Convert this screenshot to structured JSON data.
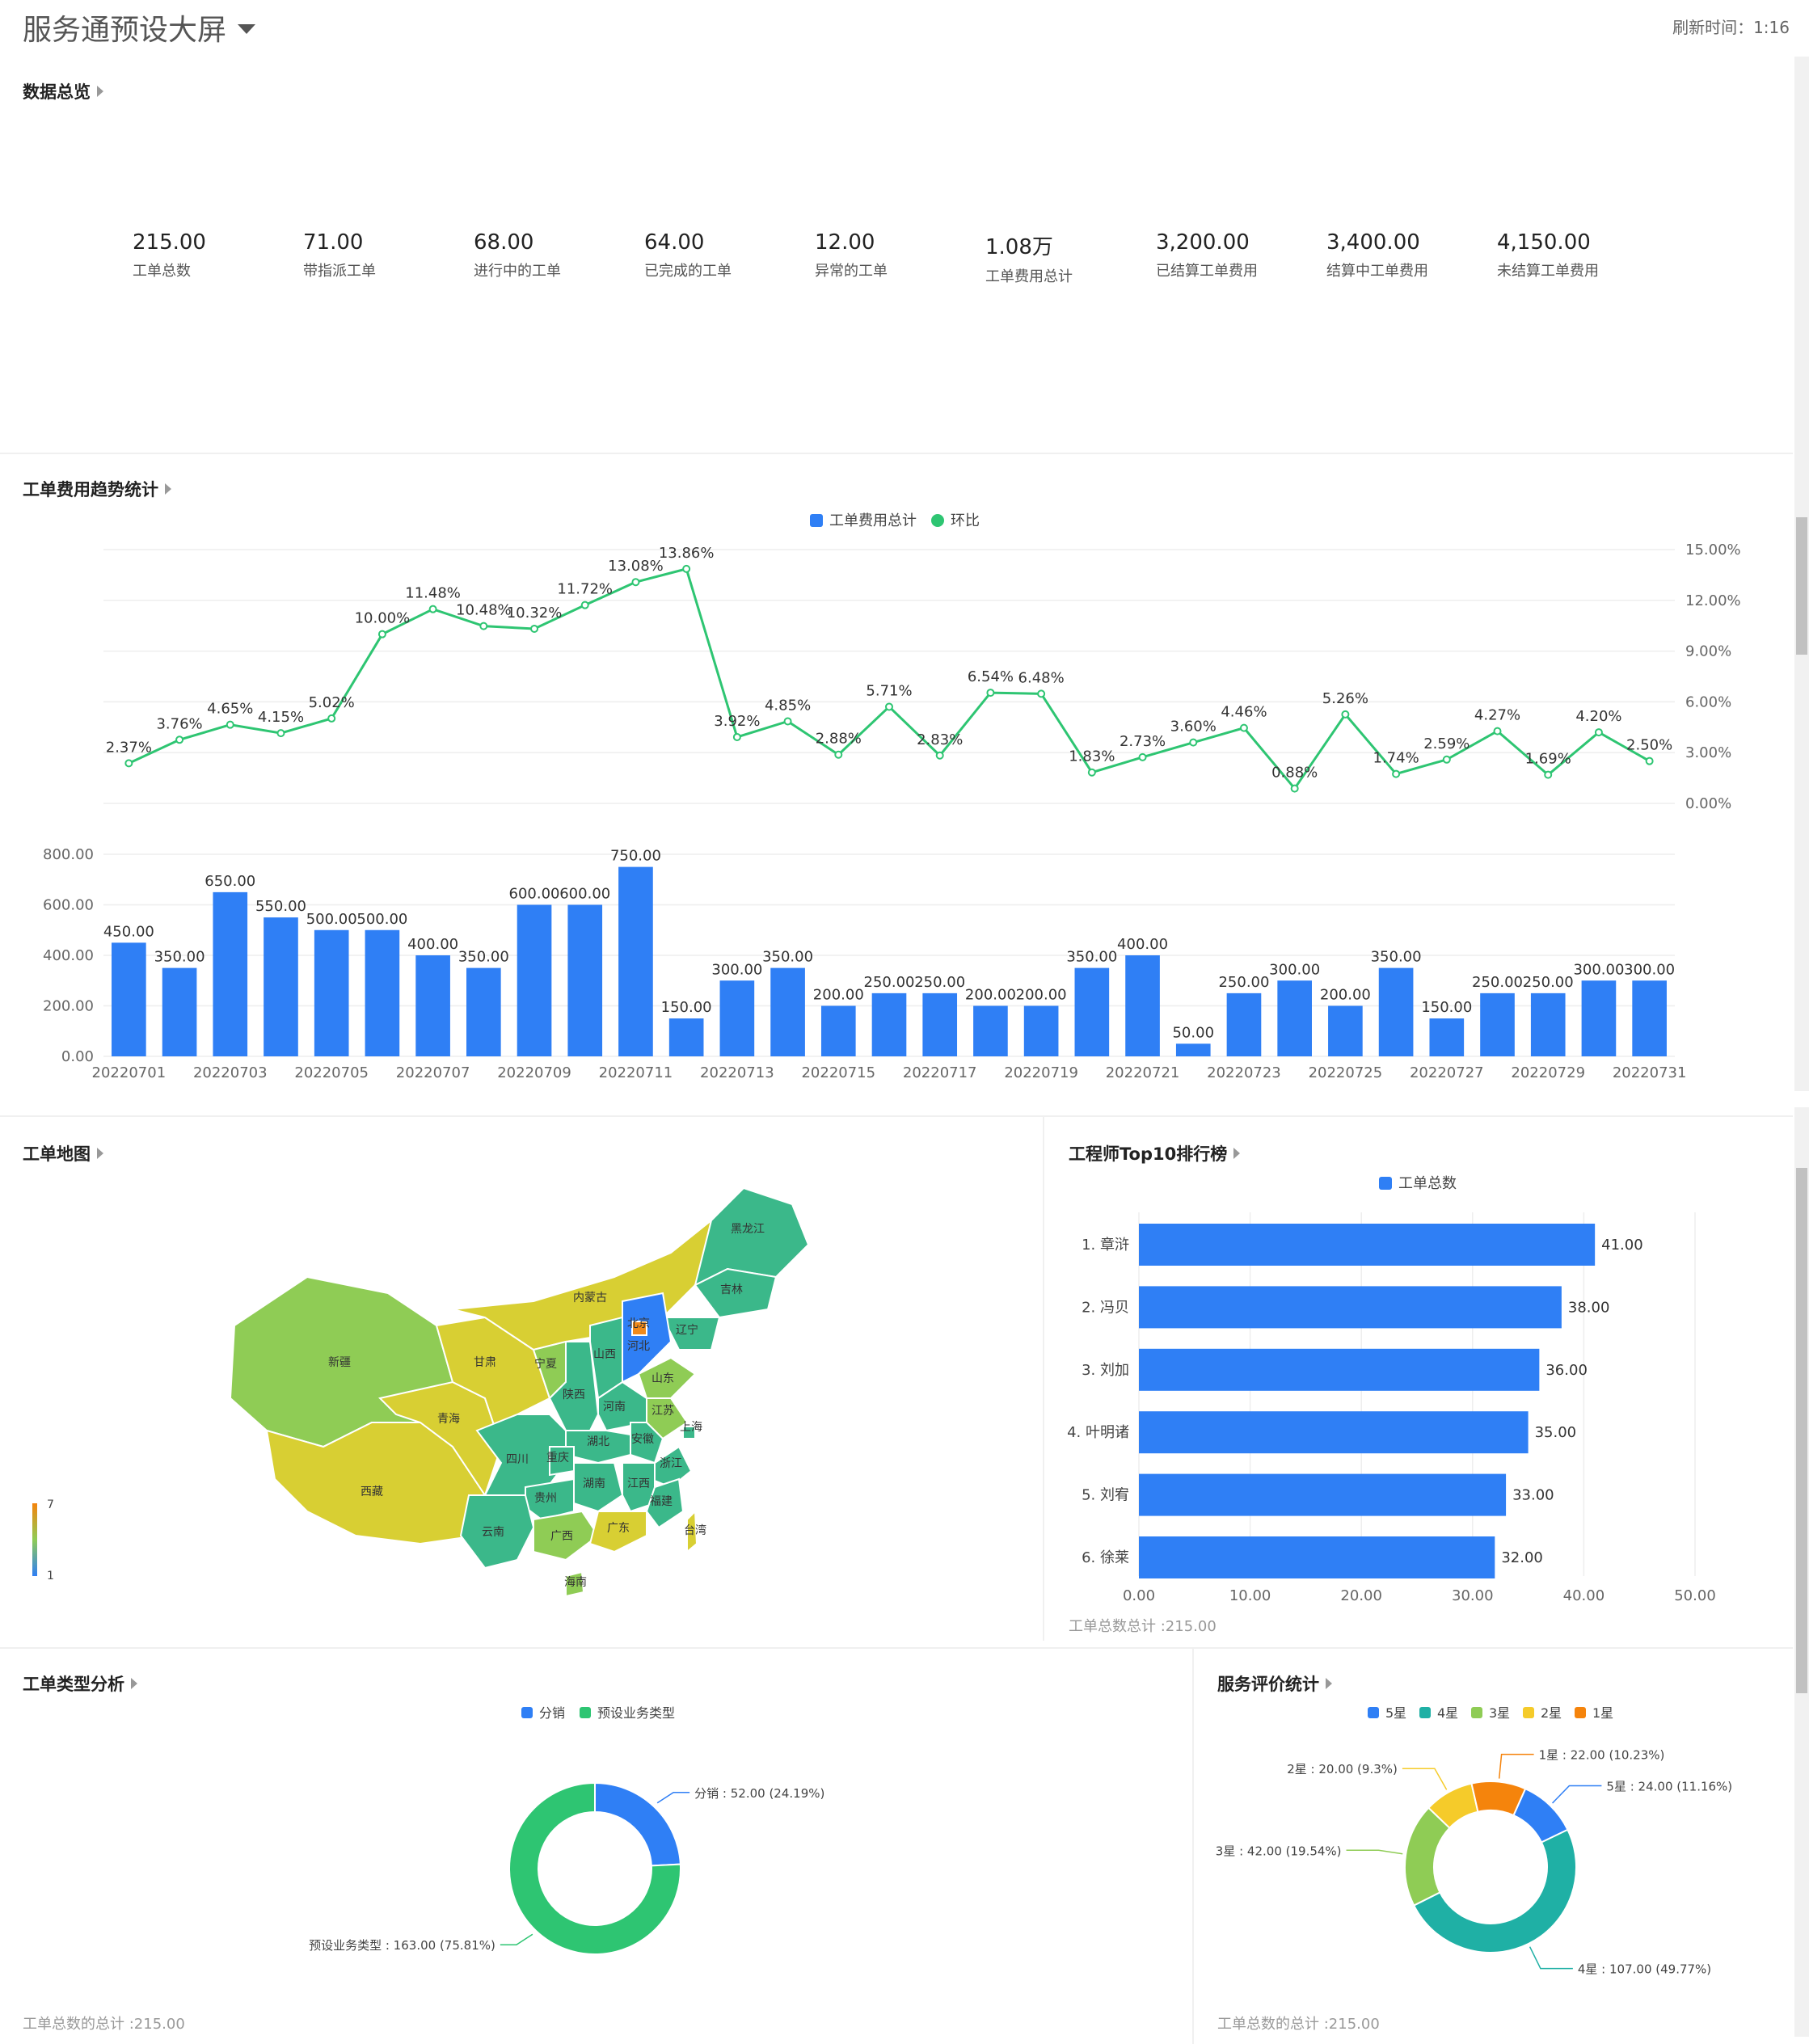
{
  "header": {
    "title": "服务通预设大屏",
    "refresh_label": "刷新时间：1:16"
  },
  "overview": {
    "title": "数据总览",
    "kpis": [
      {
        "value": "215.00",
        "label": "工单总数"
      },
      {
        "value": "71.00",
        "label": "带指派工单"
      },
      {
        "value": "68.00",
        "label": "进行中的工单"
      },
      {
        "value": "64.00",
        "label": "已完成的工单"
      },
      {
        "value": "12.00",
        "label": "异常的工单"
      },
      {
        "value": "1.08万",
        "label": "工单费用总计"
      },
      {
        "value": "3,200.00",
        "label": "已结算工单费用"
      },
      {
        "value": "3,400.00",
        "label": "结算中工单费用"
      },
      {
        "value": "4,150.00",
        "label": "未结算工单费用"
      }
    ]
  },
  "trend": {
    "title": "工单费用趋势统计",
    "legend_bar": "工单费用总计",
    "legend_line": "环比"
  },
  "map_section": {
    "title": "工单地图",
    "scale_max": "7",
    "scale_min": "1",
    "provinces": [
      {
        "name": "黑龙江",
        "color": "#3bb88a"
      },
      {
        "name": "吉林",
        "color": "#3bb88a"
      },
      {
        "name": "辽宁",
        "color": "#3bb88a"
      },
      {
        "name": "内蒙古",
        "color": "#d8cf33"
      },
      {
        "name": "新疆",
        "color": "#8fcc55"
      },
      {
        "name": "西藏",
        "color": "#d8cf33"
      },
      {
        "name": "青海",
        "color": "#d8cf33"
      },
      {
        "name": "甘肃",
        "color": "#d8cf33"
      },
      {
        "name": "宁夏",
        "color": "#8fcc55"
      },
      {
        "name": "陕西",
        "color": "#3bb88a"
      },
      {
        "name": "山西",
        "color": "#3bb88a"
      },
      {
        "name": "北京",
        "color": "#f08a1c"
      },
      {
        "name": "河北",
        "color": "#2f7ff5"
      },
      {
        "name": "山东",
        "color": "#8fcc55"
      },
      {
        "name": "河南",
        "color": "#3bb88a"
      },
      {
        "name": "江苏",
        "color": "#8fcc55"
      },
      {
        "name": "安徽",
        "color": "#3bb88a"
      },
      {
        "name": "上海",
        "color": "#3bb88a"
      },
      {
        "name": "湖北",
        "color": "#3bb88a"
      },
      {
        "name": "四川",
        "color": "#3bb88a"
      },
      {
        "name": "重庆",
        "color": "#3bb88a"
      },
      {
        "name": "浙江",
        "color": "#3bb88a"
      },
      {
        "name": "湖南",
        "color": "#3bb88a"
      },
      {
        "name": "江西",
        "color": "#3bb88a"
      },
      {
        "name": "贵州",
        "color": "#3bb88a"
      },
      {
        "name": "云南",
        "color": "#3bb88a"
      },
      {
        "name": "福建",
        "color": "#3bb88a"
      },
      {
        "name": "广西",
        "color": "#8fcc55"
      },
      {
        "name": "广东",
        "color": "#d8cf33"
      },
      {
        "name": "台湾",
        "color": "#d8cf33"
      },
      {
        "name": "海南",
        "color": "#8fcc55"
      }
    ]
  },
  "ranking": {
    "title": "工程师Top10排行榜",
    "legend": "工单总数",
    "footer": "工单总数总计 :215.00"
  },
  "type_analysis": {
    "title": "工单类型分析",
    "legend": [
      "分销",
      "预设业务类型"
    ],
    "footer": "工单总数的总计 :215.00"
  },
  "rating": {
    "title": "服务评价统计",
    "legend": [
      "5星",
      "4星",
      "3星",
      "2星",
      "1星"
    ],
    "footer": "工单总数的总计 :215.00"
  },
  "colors": {
    "blue": "#2f7ff5",
    "green": "#2ec572",
    "teal": "#1fb0a5",
    "light_green": "#8fcc55",
    "yellow": "#f5cb2a",
    "orange": "#f5840c",
    "grid": "#eeeeee",
    "axis_text": "#666666"
  },
  "chart_data": [
    {
      "type": "bar",
      "categories": [
        "20220701",
        "20220702",
        "20220703",
        "20220704",
        "20220705",
        "20220706",
        "20220707",
        "20220708",
        "20220709",
        "20220710",
        "20220711",
        "20220712",
        "20220713",
        "20220714",
        "20220715",
        "20220716",
        "20220717",
        "20220718",
        "20220719",
        "20220720",
        "20220721",
        "20220722",
        "20220723",
        "20220724",
        "20220725",
        "20220726",
        "20220727",
        "20220728",
        "20220729",
        "20220730",
        "20220731"
      ],
      "x_tick_labels": [
        "20220701",
        "20220703",
        "20220705",
        "20220707",
        "20220709",
        "20220711",
        "20220713",
        "20220715",
        "20220717",
        "20220719",
        "20220721",
        "20220723",
        "20220725",
        "20220727",
        "20220729",
        "20220731"
      ],
      "series": [
        {
          "name": "工单费用总计",
          "type": "bar",
          "values": [
            450,
            350,
            650,
            550,
            500,
            500,
            400,
            350,
            600,
            600,
            750,
            150,
            300,
            350,
            200,
            250,
            250,
            200,
            200,
            350,
            400,
            50,
            250,
            300,
            200,
            350,
            150,
            250,
            250,
            300,
            300
          ]
        },
        {
          "name": "环比",
          "type": "line",
          "values": [
            2.37,
            3.76,
            4.65,
            4.15,
            5.02,
            10.0,
            11.48,
            10.48,
            10.32,
            11.72,
            13.08,
            13.86,
            3.92,
            4.85,
            2.88,
            5.71,
            2.83,
            6.54,
            6.48,
            1.83,
            2.73,
            3.6,
            4.46,
            0.88,
            5.26,
            1.74,
            2.59,
            4.27,
            1.69,
            4.2,
            2.5
          ]
        }
      ],
      "bar_labels": [
        "450.00",
        "350.00",
        "650.00",
        "550.00",
        "500.00",
        "500.00",
        "400.00",
        "350.00",
        "600.00",
        "600.00",
        "750.00",
        "150.00",
        "300.00",
        "350.00",
        "200.00",
        "250.00",
        "250.00",
        "200.00",
        "200.00",
        "350.00",
        "400.00",
        "50.00",
        "250.00",
        "300.00",
        "200.00",
        "350.00",
        "150.00",
        "250.00",
        "250.00",
        "300.00",
        "300.00"
      ],
      "line_labels": [
        "2.37%",
        "3.76%",
        "4.65%",
        "4.15%",
        "5.02%",
        "10.00%",
        "11.48%",
        "10.48%",
        "10.32%",
        "11.72%",
        "13.08%",
        "13.86%",
        "3.92%",
        "4.85%",
        "2.88%",
        "5.71%",
        "2.83%",
        "6.54%",
        "6.48%",
        "1.83%",
        "2.73%",
        "3.60%",
        "4.46%",
        "0.88%",
        "5.26%",
        "1.74%",
        "2.59%",
        "4.27%",
        "1.69%",
        "4.20%",
        "2.50%"
      ],
      "bar_ylim": [
        0,
        800
      ],
      "bar_yticks": [
        "0.00",
        "200.00",
        "400.00",
        "600.00",
        "800.00"
      ],
      "line_ylim": [
        0,
        15
      ],
      "line_yticks": [
        "0.00%",
        "3.00%",
        "6.00%",
        "9.00%",
        "12.00%",
        "15.00%"
      ],
      "grid": true
    },
    {
      "type": "bar",
      "orientation": "horizontal",
      "categories": [
        "1. 章浒",
        "2. 冯贝",
        "3. 刘加",
        "4. 叶明诸",
        "5. 刘宥",
        "6. 徐莱"
      ],
      "values": [
        41,
        38,
        36,
        35,
        33,
        32
      ],
      "value_labels": [
        "41.00",
        "38.00",
        "36.00",
        "35.00",
        "33.00",
        "32.00"
      ],
      "xlim": [
        0,
        50
      ],
      "xticks": [
        "0.00",
        "10.00",
        "20.00",
        "30.00",
        "40.00",
        "50.00"
      ],
      "series_name": "工单总数"
    },
    {
      "type": "pie",
      "style": "donut",
      "slices": [
        {
          "name": "分销",
          "value": 52,
          "label": "分销 : 52.00 (24.19%)",
          "color": "#2f7ff5"
        },
        {
          "name": "预设业务类型",
          "value": 163,
          "label": "预设业务类型 : 163.00 (75.81%)",
          "color": "#2ec572"
        }
      ]
    },
    {
      "type": "pie",
      "style": "donut",
      "slices": [
        {
          "name": "5星",
          "value": 24,
          "label": "5星 : 24.00 (11.16%)",
          "color": "#2f7ff5"
        },
        {
          "name": "4星",
          "value": 107,
          "label": "4星 : 107.00 (49.77%)",
          "color": "#1fb0a5"
        },
        {
          "name": "3星",
          "value": 42,
          "label": "3星 : 42.00 (19.54%)",
          "color": "#8fcc55"
        },
        {
          "name": "2星",
          "value": 20,
          "label": "2星 : 20.00 (9.3%)",
          "color": "#f5cb2a"
        },
        {
          "name": "1星",
          "value": 22,
          "label": "1星 : 22.00 (10.23%)",
          "color": "#f5840c"
        }
      ]
    }
  ]
}
